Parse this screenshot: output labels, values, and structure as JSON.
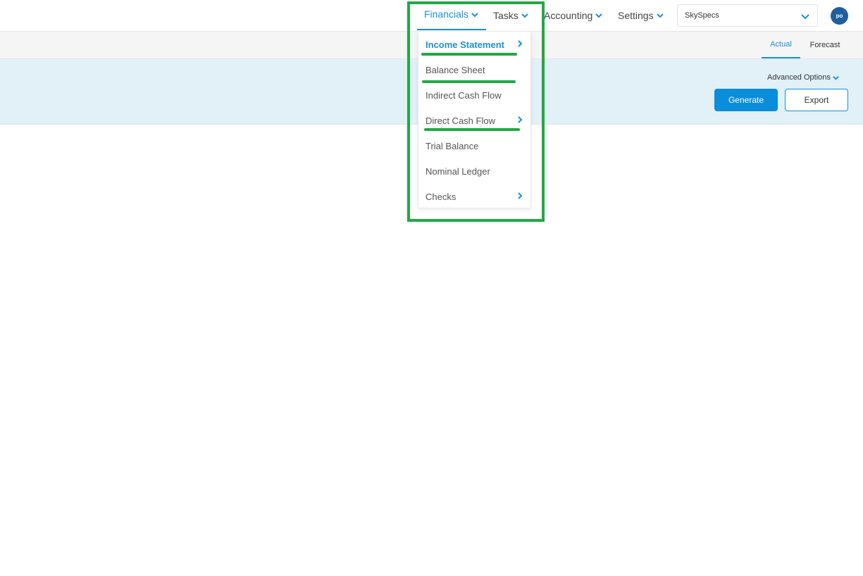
{
  "nav": {
    "financials": "Financials",
    "tasks": "Tasks",
    "accounting": "Accounting",
    "settings": "Settings"
  },
  "company_select": {
    "value": "SkySpecs"
  },
  "avatar": {
    "initials": "po"
  },
  "tabs": {
    "actual": "Actual",
    "forecast": "Forecast",
    "selected": "Actual"
  },
  "options": {
    "advanced": "Advanced Options",
    "generate": "Generate",
    "export": "Export"
  },
  "menu": {
    "items": [
      {
        "label": "Income Statement",
        "submenu": true,
        "active": true
      },
      {
        "label": "Balance Sheet",
        "submenu": false
      },
      {
        "label": "Indirect Cash Flow",
        "submenu": false
      },
      {
        "label": "Direct Cash Flow",
        "submenu": true
      },
      {
        "label": "Trial Balance",
        "submenu": false
      },
      {
        "label": "Nominal Ledger",
        "submenu": false
      },
      {
        "label": "Checks",
        "submenu": true
      }
    ]
  },
  "colors": {
    "accent": "#1a8fd6",
    "generate_bg": "#0a8edb",
    "band_bg": "#e2f1f8",
    "avatar_bg": "#1f5f9e",
    "highlight": "#22a845"
  },
  "icons": {
    "nav_chevron": "chevron-down-icon",
    "submenu_arrow": "chevron-right-icon"
  }
}
